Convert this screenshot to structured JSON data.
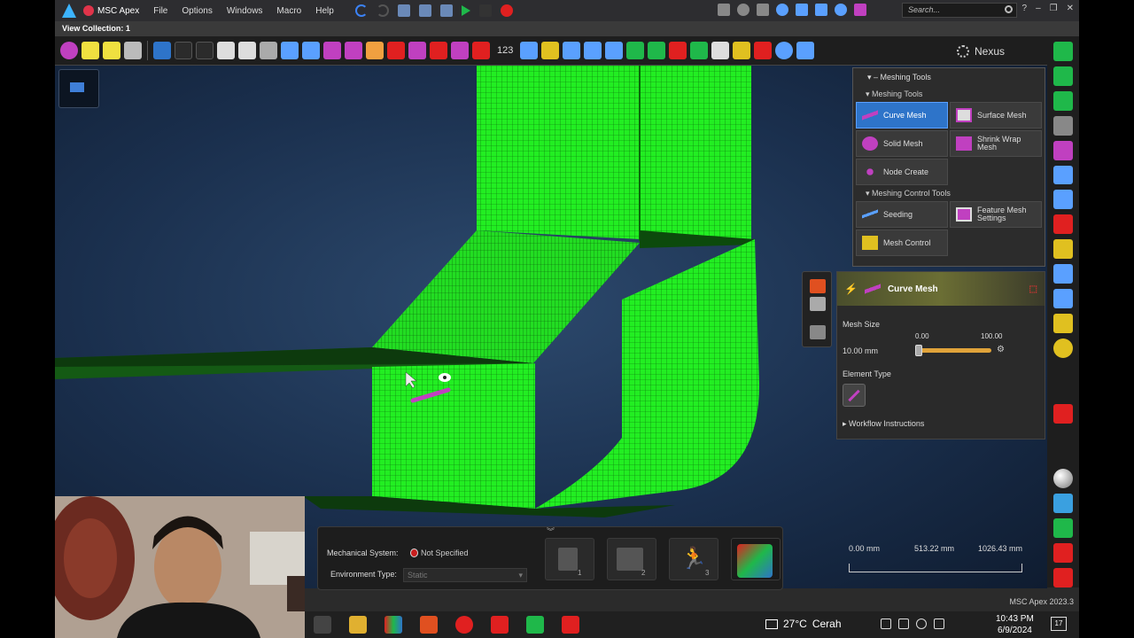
{
  "app": {
    "brand": "MSC Apex",
    "menu": [
      "File",
      "Options",
      "Windows",
      "Macro",
      "Help"
    ],
    "search_placeholder": "Search...",
    "view_collection": "View Collection: 1",
    "ribbon_counter": "123",
    "nexus_label": "Nexus"
  },
  "meshing_panel": {
    "header": "Meshing Tools",
    "section1": "Meshing Tools",
    "tools": [
      {
        "label": "Curve Mesh",
        "icon": "curve-mesh-icon",
        "active": true
      },
      {
        "label": "Surface Mesh",
        "icon": "surface-mesh-icon"
      },
      {
        "label": "Solid Mesh",
        "icon": "solid-mesh-icon"
      },
      {
        "label": "Shrink Wrap Mesh",
        "icon": "shrink-wrap-icon"
      },
      {
        "label": "Node Create",
        "icon": "node-create-icon"
      }
    ],
    "section2": "Meshing Control Tools",
    "control_tools": [
      {
        "label": "Seeding",
        "icon": "seeding-icon"
      },
      {
        "label": "Feature Mesh Settings",
        "icon": "feature-mesh-icon"
      },
      {
        "label": "Mesh Control",
        "icon": "mesh-control-icon"
      }
    ]
  },
  "curve_mesh": {
    "title": "Curve Mesh",
    "mesh_size_label": "Mesh Size",
    "mesh_size_value": "10.00 mm",
    "slider_min": "0.00",
    "slider_max": "100.00",
    "slider_fraction": 0.0,
    "element_type_label": "Element Type",
    "workflow": "Workflow Instructions"
  },
  "bottom_bar": {
    "mech_label": "Mechanical System:",
    "mech_value": "Not Specified",
    "env_label": "Environment Type:",
    "env_value": "Static",
    "steps": [
      "1",
      "2",
      "3"
    ]
  },
  "scale": {
    "labels": [
      "0.00 mm",
      "513.22 mm",
      "1026.43 mm"
    ]
  },
  "status": {
    "version": "MSC Apex 2023.3"
  },
  "taskbar": {
    "weather_temp": "27°C",
    "weather_desc": "Cerah",
    "time": "10:43 PM",
    "date": "6/9/2024",
    "notifications": "17"
  },
  "colors": {
    "mesh_green": "#22ee22",
    "active_blue": "#2e74c9",
    "accent_orange": "#e0a33a"
  }
}
